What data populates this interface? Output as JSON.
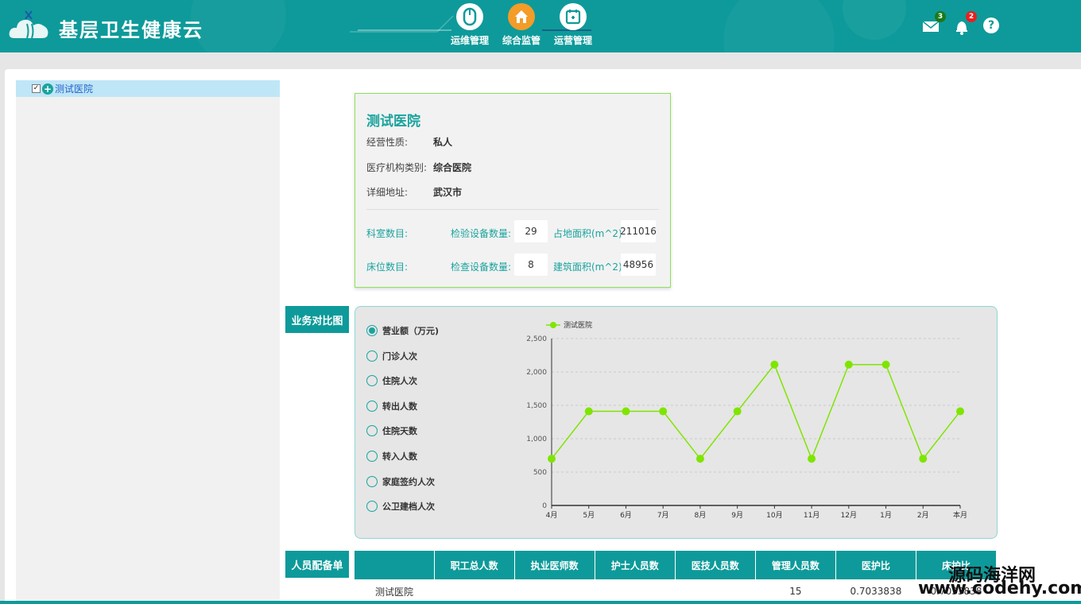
{
  "header": {
    "brand": "基层卫生健康云",
    "nav": [
      {
        "label": "运维管理",
        "icon": "mouse-icon"
      },
      {
        "label": "综合监管",
        "icon": "house-icon"
      },
      {
        "label": "运营管理",
        "icon": "calendar-icon"
      }
    ],
    "mail_badge": "3",
    "notify_badge": "2",
    "help_glyph": "?"
  },
  "tree": {
    "root_label": "测试医院",
    "checked_glyph": "✓"
  },
  "hospital": {
    "name": "测试医院",
    "nature_label": "经营性质:",
    "nature_value": "私人",
    "category_label": "医疗机构类别:",
    "category_value": "综合医院",
    "address_label": "详细地址:",
    "address_value": "武汉市",
    "dept_count_label": "科室数目:",
    "bed_count_label": "床位数目:",
    "lab_equip_label": "检验设备数量:",
    "lab_equip_value": "29",
    "exam_equip_label": "检查设备数量:",
    "exam_equip_value": "8",
    "land_area_label": "占地面积(m^2):",
    "land_area_value": "211016",
    "build_area_label": "建筑面积(m^2):",
    "build_area_value": "48956"
  },
  "business": {
    "section_title": "业务对比图",
    "radios": [
      "营业额（万元)",
      "门诊人次",
      "住院人次",
      "转出人数",
      "住院天数",
      "转入人数",
      "家庭签约人次",
      "公卫建档人次"
    ],
    "selected": 0
  },
  "chart_data": {
    "type": "line",
    "categories": [
      "4月",
      "5月",
      "6月",
      "7月",
      "8月",
      "9月",
      "10月",
      "11月",
      "12月",
      "1月",
      "2月",
      "本月"
    ],
    "series": [
      {
        "name": "测试医院",
        "values": [
          700,
          1410,
          1410,
          1410,
          700,
          1410,
          2110,
          700,
          2110,
          2110,
          700,
          1410
        ]
      }
    ],
    "ylim": [
      0,
      2500
    ],
    "yticks": [
      "0",
      "500",
      "1,000",
      "1,500",
      "2,000",
      "2,500"
    ],
    "grid": true,
    "legend": "top-left",
    "color": "#7fe500"
  },
  "staff": {
    "section_title": "人员配备单",
    "headers": [
      "",
      "职工总人数",
      "执业医师数",
      "护士人员数",
      "医技人员数",
      "管理人员数",
      "医护比",
      "床护比"
    ],
    "rows": [
      [
        "测试医院",
        "",
        "",
        "",
        "",
        "15",
        "0.7033838",
        "0.7033838"
      ]
    ]
  },
  "watermark": {
    "line1": "源码海洋网",
    "line2": "www.codehy.com"
  }
}
